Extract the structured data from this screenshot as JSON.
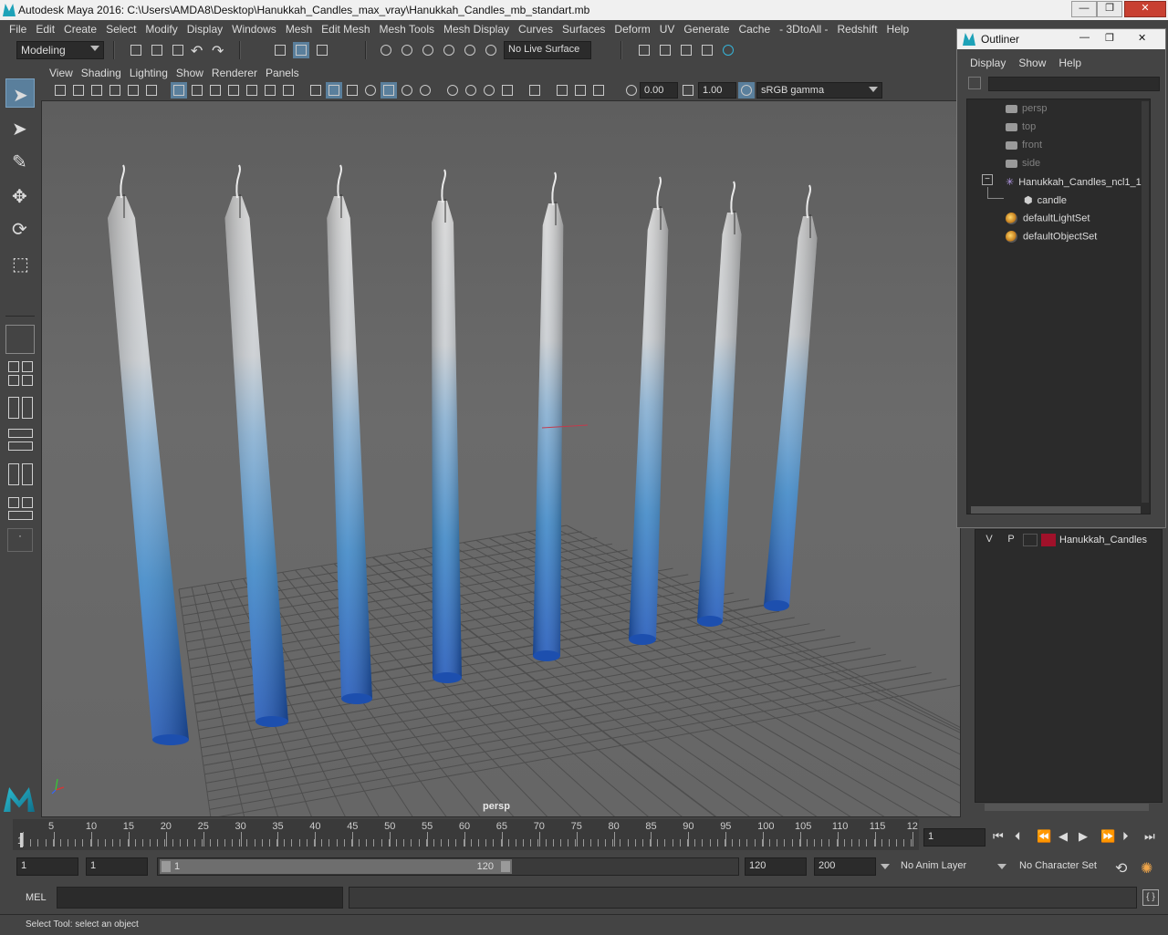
{
  "window": {
    "title": "Autodesk Maya 2016: C:\\Users\\AMDA8\\Desktop\\Hanukkah_Candles_max_vray\\Hanukkah_Candles_mb_standart.mb",
    "minimize": "—",
    "maximize": "❐",
    "close": "✕"
  },
  "menubar": [
    "File",
    "Edit",
    "Create",
    "Select",
    "Modify",
    "Display",
    "Windows",
    "Mesh",
    "Edit Mesh",
    "Mesh Tools",
    "Mesh Display",
    "Curves",
    "Surfaces",
    "Deform",
    "UV",
    "Generate",
    "Cache",
    "- 3DtoAll -",
    "Redshift",
    "Help"
  ],
  "status": {
    "mode": "Modeling",
    "live_surface": "No Live Surface"
  },
  "panel_menu": [
    "View",
    "Shading",
    "Lighting",
    "Show",
    "Renderer",
    "Panels"
  ],
  "panel_tools": {
    "exposure": "0.00",
    "gamma": "1.00",
    "color_space": "sRGB gamma"
  },
  "viewport": {
    "camera_label": "persp",
    "candle_count": 8
  },
  "outliner": {
    "title": "Outliner",
    "menu": [
      "Display",
      "Show",
      "Help"
    ],
    "items": [
      {
        "label": "persp",
        "kind": "camera"
      },
      {
        "label": "top",
        "kind": "camera"
      },
      {
        "label": "front",
        "kind": "camera"
      },
      {
        "label": "side",
        "kind": "camera"
      },
      {
        "label": "Hanukkah_Candles_ncl1_1",
        "kind": "group"
      },
      {
        "label": "candle",
        "kind": "mesh"
      },
      {
        "label": "defaultLightSet",
        "kind": "set"
      },
      {
        "label": "defaultObjectSet",
        "kind": "set"
      }
    ],
    "expand_toggle": "−"
  },
  "layer": {
    "visible": "V",
    "playback": "P",
    "name": "Hanukkah_Candles",
    "color": "#a0112a"
  },
  "timeline": {
    "ticks": [
      "1",
      "5",
      "10",
      "15",
      "20",
      "25",
      "30",
      "35",
      "40",
      "45",
      "50",
      "55",
      "60",
      "65",
      "70",
      "75",
      "80",
      "85",
      "90",
      "95",
      "100",
      "105",
      "110",
      "115",
      "12"
    ],
    "current_frame": "1"
  },
  "range": {
    "start": "1",
    "anim_start": "1",
    "range_start_label": "1",
    "range_end_label": "120",
    "anim_end": "120",
    "end": "200",
    "anim_layer": "No Anim Layer",
    "character_set": "No Character Set"
  },
  "command": {
    "label": "MEL"
  },
  "help_line": "Select Tool: select an object",
  "colors": {
    "accent": "#5a7f9c",
    "candle_top": "#d0d0d0",
    "candle_bottom": "#1e55b8"
  }
}
